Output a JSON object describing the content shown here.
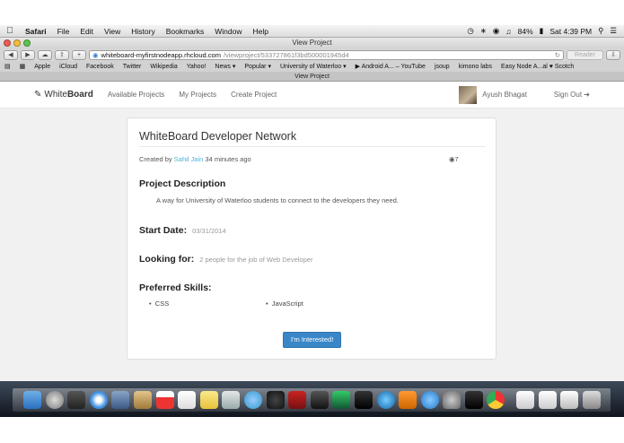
{
  "menubar": {
    "app": "Safari",
    "items": [
      "File",
      "Edit",
      "View",
      "History",
      "Bookmarks",
      "Window",
      "Help"
    ],
    "battery": "84%",
    "clock": "Sat 4:39 PM"
  },
  "browser": {
    "window_title": "View Project",
    "url_host": "whiteboard-myfirstnodeapp.rhcloud.com",
    "url_path": "/viewproject/533727861f3bd500001945d4",
    "reader_label": "Reader",
    "tab_title": "View Project",
    "bookmarks": [
      "Apple",
      "iCloud",
      "Facebook",
      "Twitter",
      "Wikipedia",
      "Yahoo!",
      "News ▾",
      "Popular ▾",
      "University of Waterloo ▾",
      "▶ Android A... – YouTube",
      "jsoup",
      "kimono labs",
      "Easy Node A...al ♥ Scotch"
    ]
  },
  "navbar": {
    "brand_light": "White",
    "brand_bold": "Board",
    "links": [
      "Available Projects",
      "My Projects",
      "Create Project"
    ],
    "user_name": "Ayush Bhagat",
    "sign_out": "Sign Out"
  },
  "project": {
    "title": "WhiteBoard Developer Network",
    "created_by_prefix": "Created by",
    "author": "Sahil Jain",
    "created_ago": "34 minutes ago",
    "views": "7",
    "description_heading": "Project Description",
    "description": "A way for University of Waterloo students to connect to the developers they need.",
    "start_date_label": "Start Date:",
    "start_date": "03/31/2014",
    "looking_for_label": "Looking for:",
    "looking_for": "2 people for the job of Web Developer",
    "skills_label": "Preferred Skills:",
    "skills": [
      "CSS",
      "JavaScript"
    ],
    "interested_button": "I'm Interested!"
  }
}
